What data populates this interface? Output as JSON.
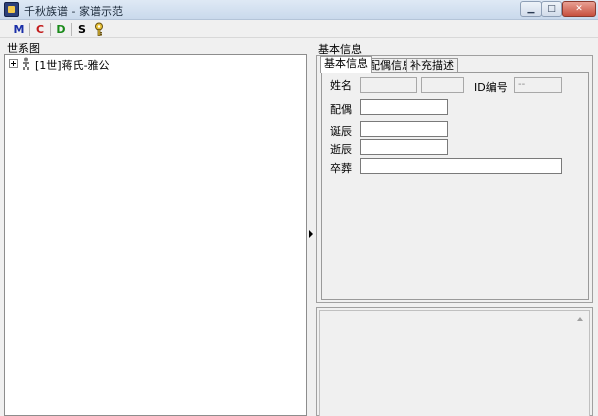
{
  "window": {
    "title": "千秋族谱 - 家谱示范",
    "minimize_glyph": "▁",
    "maximize_glyph": "□",
    "close_glyph": "✕"
  },
  "toolbar": {
    "buttons": [
      {
        "label": "M",
        "color": "#1a2fa8"
      },
      {
        "label": "C",
        "color": "#c21a1a"
      },
      {
        "label": "D",
        "color": "#1a8a1a"
      },
      {
        "label": "S",
        "color": "#000000"
      }
    ],
    "key_icon": "key-icon"
  },
  "left_panel": {
    "header": "世系图",
    "tree": [
      {
        "label": "[1世]蒋氏-雅公"
      }
    ]
  },
  "right_panel": {
    "header": "基本信息",
    "tabs": [
      {
        "label": "基本信息",
        "active": true
      },
      {
        "label": "配偶信息",
        "active": false
      },
      {
        "label": "补充描述",
        "active": false
      }
    ],
    "form": {
      "name_label": "姓名",
      "id_label": "ID编号",
      "id_value": "--",
      "spouse_label": "配偶",
      "birth_label": "诞辰",
      "death_label": "逝辰",
      "burial_label": "卒葬"
    }
  }
}
